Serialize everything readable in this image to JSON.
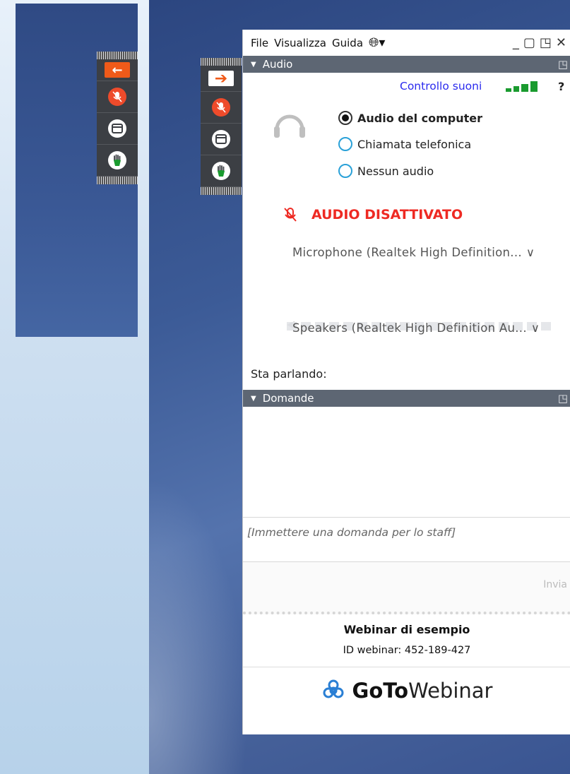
{
  "menu": {
    "file": "File",
    "view": "Visualizza",
    "help": "Guida"
  },
  "window_controls": [
    "minimize-icon",
    "restore-icon",
    "popout-icon",
    "close-icon"
  ],
  "audio_section": {
    "title": "Audio",
    "sound_check": "Controllo suoni",
    "help": "?",
    "options": [
      {
        "label": "Audio del computer",
        "selected": true
      },
      {
        "label": "Chiamata telefonica",
        "selected": false
      },
      {
        "label": "Nessun audio",
        "selected": false
      }
    ],
    "muted_label": "AUDIO DISATTIVATO",
    "microphone": "Microphone (Realtek High Definition...",
    "speakers": "Speakers (Realtek High Definition Au...",
    "talking_label": "Sta parlando:"
  },
  "questions_section": {
    "title": "Domande",
    "placeholder": "[Immettere una domanda per lo staff]",
    "send": "Invia"
  },
  "webinar": {
    "title": "Webinar di esempio",
    "id_label": "ID webinar: 452-189-427",
    "logo_goto": "GoTo",
    "logo_webinar": "Webinar"
  },
  "colors": {
    "accent_orange": "#f05a19",
    "mic_red": "#ee4b2b",
    "muted_red": "#ee2a23",
    "header_gray": "#5d6673",
    "link_blue": "#2a2aee"
  }
}
